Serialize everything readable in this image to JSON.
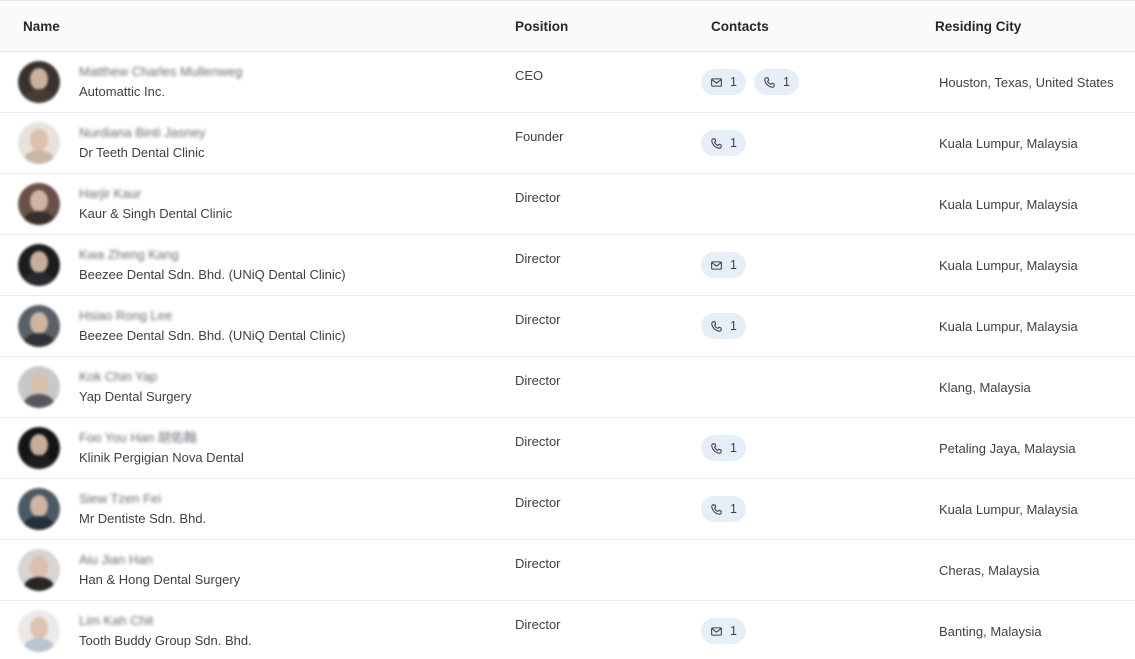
{
  "headers": {
    "name": "Name",
    "position": "Position",
    "contacts": "Contacts",
    "city": "Residing City"
  },
  "rows": [
    {
      "name": "Matthew Charles Mullenweg",
      "company": "Automattic Inc.",
      "position": "CEO",
      "email": "1",
      "phone": "1",
      "city": "Houston, Texas, United States",
      "avatar_bg": "#3a3230",
      "avatar_body": "#4a3a36"
    },
    {
      "name": "Nurdiana Binti Jasney",
      "company": "Dr Teeth Dental Clinic",
      "position": "Founder",
      "email": null,
      "phone": "1",
      "city": "Kuala Lumpur, Malaysia",
      "avatar_bg": "#e8e2dc",
      "avatar_body": "#c9b7a6"
    },
    {
      "name": "Harjir Kaur",
      "company": "Kaur & Singh Dental Clinic",
      "position": "Director",
      "email": null,
      "phone": null,
      "city": "Kuala Lumpur, Malaysia",
      "avatar_bg": "#6a5048",
      "avatar_body": "#3a2e2a"
    },
    {
      "name": "Kwa Zheng Kang",
      "company": "Beezee Dental Sdn. Bhd. (UNiQ Dental Clinic)",
      "position": "Director",
      "email": "1",
      "phone": null,
      "city": "Kuala Lumpur, Malaysia",
      "avatar_bg": "#1c1c1f",
      "avatar_body": "#2a2a2e"
    },
    {
      "name": "Hsiao Rong Lee",
      "company": "Beezee Dental Sdn. Bhd. (UNiQ Dental Clinic)",
      "position": "Director",
      "email": null,
      "phone": "1",
      "city": "Kuala Lumpur, Malaysia",
      "avatar_bg": "#5a6068",
      "avatar_body": "#2e3238"
    },
    {
      "name": "Kok Chin Yap",
      "company": "Yap Dental Surgery",
      "position": "Director",
      "email": null,
      "phone": null,
      "city": "Klang, Malaysia",
      "avatar_bg": "#c8c8cc",
      "avatar_body": "#55585e"
    },
    {
      "name": "Foo You Han 胡佑翰",
      "company": "Klinik Pergigian Nova Dental",
      "position": "Director",
      "email": null,
      "phone": "1",
      "city": "Petaling Jaya, Malaysia",
      "avatar_bg": "#141416",
      "avatar_body": "#1e1e22"
    },
    {
      "name": "Siew Tzen Fei",
      "company": "Mr Dentiste Sdn. Bhd.",
      "position": "Director",
      "email": null,
      "phone": "1",
      "city": "Kuala Lumpur, Malaysia",
      "avatar_bg": "#4c5a66",
      "avatar_body": "#26303a"
    },
    {
      "name": "Aiu Jian Han",
      "company": "Han & Hong Dental Surgery",
      "position": "Director",
      "email": null,
      "phone": null,
      "city": "Cheras, Malaysia",
      "avatar_bg": "#d8d4d0",
      "avatar_body": "#2a2624"
    },
    {
      "name": "Lim Kah Chit",
      "company": "Tooth Buddy Group Sdn. Bhd.",
      "position": "Director",
      "email": "1",
      "phone": null,
      "city": "Banting, Malaysia",
      "avatar_bg": "#eceae8",
      "avatar_body": "#b8c4d0"
    }
  ],
  "colors": {
    "chip_bg": "#e6eef7",
    "header_bg": "#fafafa",
    "row_border": "#ececee"
  },
  "icons": {
    "email": "mail-icon",
    "phone": "phone-icon"
  }
}
